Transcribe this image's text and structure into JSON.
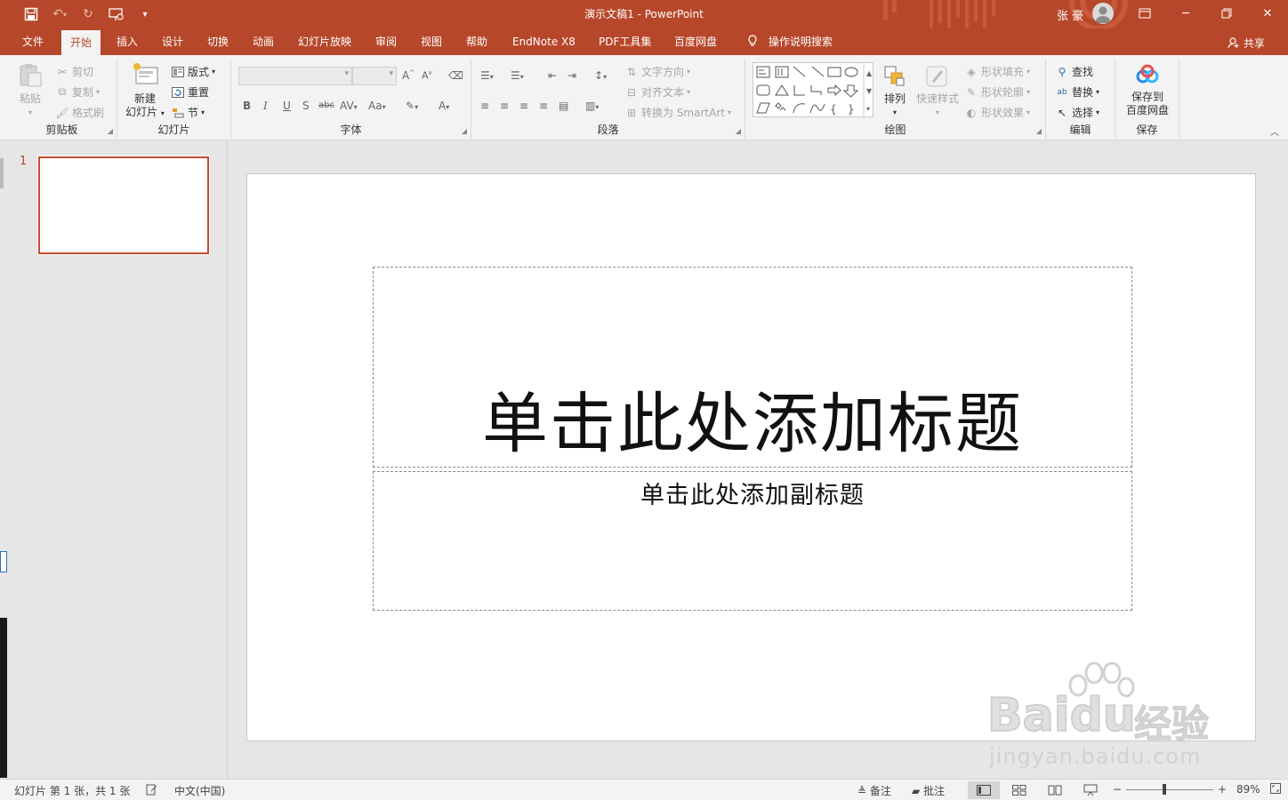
{
  "window": {
    "title": "演示文稿1  -  PowerPoint",
    "user": "张 豪"
  },
  "qat": {
    "save_icon": "save-icon",
    "undo_icon": "undo-icon",
    "redo_icon": "redo-icon",
    "present_icon": "present-icon"
  },
  "tabs": [
    "文件",
    "开始",
    "插入",
    "设计",
    "切换",
    "动画",
    "幻灯片放映",
    "审阅",
    "视图",
    "帮助",
    "EndNote X8",
    "PDF工具集",
    "百度网盘",
    "操作说明搜索"
  ],
  "share": "共享",
  "ribbon": {
    "clipboard": {
      "label": "剪贴板",
      "paste": "粘贴",
      "cut": "剪切",
      "copy": "复制",
      "format_painter": "格式刷"
    },
    "slides": {
      "label": "幻灯片",
      "new_slide_1": "新建",
      "new_slide_2": "幻灯片",
      "layout": "版式",
      "reset": "重置",
      "section": "节"
    },
    "font": {
      "label": "字体"
    },
    "paragraph": {
      "label": "段落",
      "text_direction": "文字方向",
      "align_text": "对齐文本",
      "smartart": "转换为 SmartArt"
    },
    "drawing": {
      "label": "绘图",
      "arrange": "排列",
      "quick_styles": "快速样式",
      "shape_fill": "形状填充",
      "shape_outline": "形状轮廓",
      "shape_effects": "形状效果"
    },
    "editing": {
      "label": "编辑",
      "find": "查找",
      "replace": "替换",
      "select": "选择"
    },
    "save": {
      "label": "保存",
      "save_to_1": "保存到",
      "save_to_2": "百度网盘"
    }
  },
  "thumbnails": [
    {
      "number": "1"
    }
  ],
  "slide": {
    "title_placeholder": "单击此处添加标题",
    "subtitle_placeholder": "单击此处添加副标题"
  },
  "watermark": {
    "brand": "Bai",
    "brand2": "du",
    "brand_cn": "经验",
    "url": "jingyan.baidu.com"
  },
  "status": {
    "slide_info": "幻灯片 第 1 张，共 1 张",
    "language": "中文(中国)",
    "notes": "备注",
    "comments": "批注",
    "zoom": "89%"
  },
  "colors": {
    "accent": "#b7472a",
    "ribbon_bg": "#f3f3f3"
  }
}
